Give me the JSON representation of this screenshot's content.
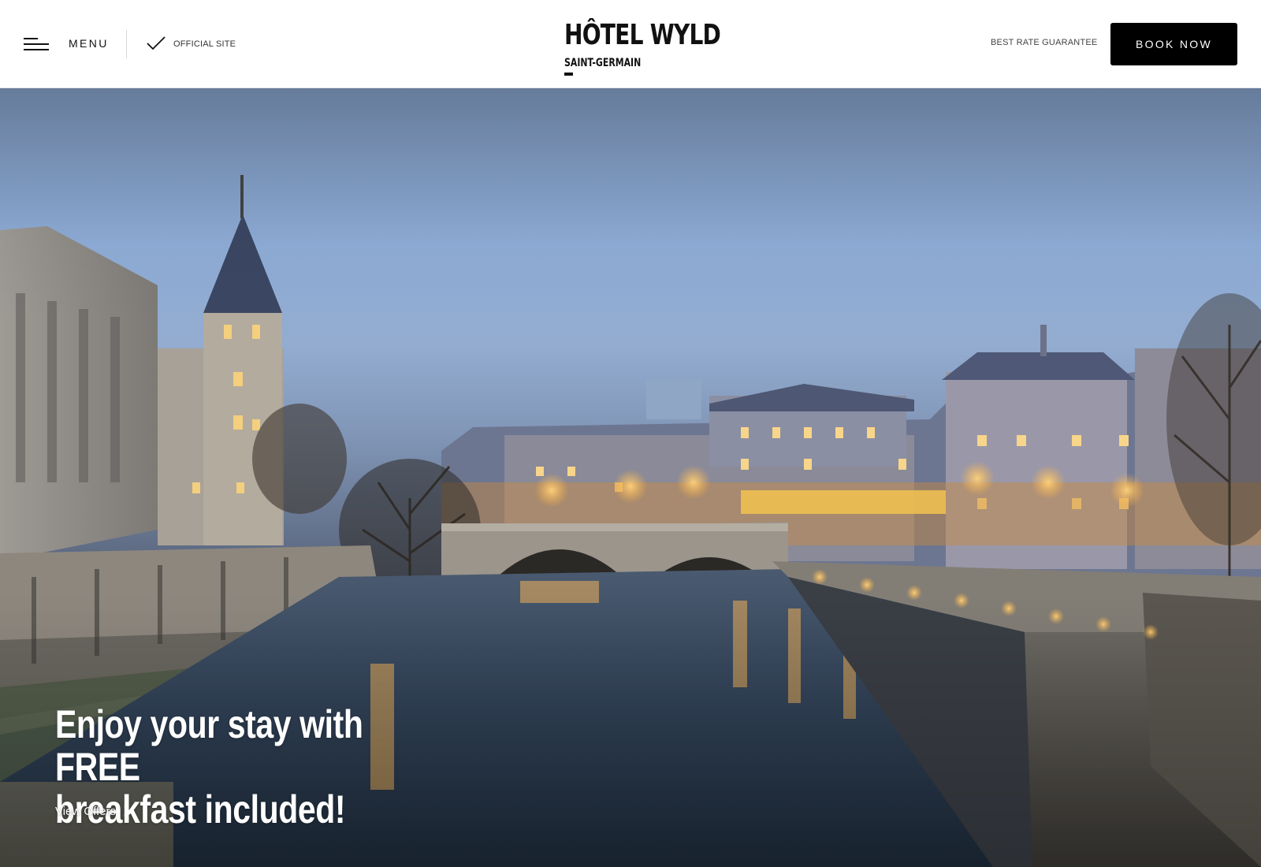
{
  "header": {
    "menu_label": "MENU",
    "official_site_label": "OFFICIAL SITE",
    "logo_main": "HÔTEL WYLD",
    "logo_sub": "SAINT-GERMAIN",
    "best_rate_label": "BEST RATE GUARANTEE",
    "book_now_label": "BOOK NOW"
  },
  "hero": {
    "headline_line1": "Enjoy your stay with FREE",
    "headline_line2": "breakfast included!",
    "cta_label": "View Offers"
  },
  "colors": {
    "header_bg": "#ffffff",
    "book_button_bg": "#000000",
    "hero_text": "#ffffff"
  },
  "icons": [
    "hamburger-icon",
    "check-icon",
    "chevron-right-icon"
  ]
}
